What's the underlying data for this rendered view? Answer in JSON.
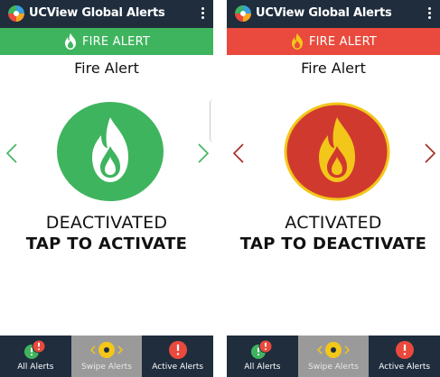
{
  "screens": [
    {
      "app_title": "UCView Global Alerts",
      "banner_label": "FIRE ALERT",
      "alert_title": "Fire Alert",
      "status": "DEACTIVATED",
      "action": "TAP TO ACTIVATE",
      "colors": {
        "banner": "#3fb45e",
        "icon_fill": "#3fb45e",
        "flame": "#ffffff",
        "arrows": "#3fb45e"
      },
      "nav": [
        {
          "label": "All Alerts",
          "icon": "all-alerts-icon",
          "selected": false
        },
        {
          "label": "Swipe Alerts",
          "icon": "swipe-alerts-icon",
          "selected": true
        },
        {
          "label": "Active Alerts",
          "icon": "active-alerts-icon",
          "selected": false
        }
      ]
    },
    {
      "app_title": "UCView Global Alerts",
      "banner_label": "FIRE ALERT",
      "alert_title": "Fire Alert",
      "status": "ACTIVATED",
      "action": "TAP TO DEACTIVATE",
      "colors": {
        "banner": "#e94a3d",
        "icon_fill": "#d03a2e",
        "icon_ring": "#f3c71a",
        "flame": "#f3c71a",
        "arrows": "#a32a1f"
      },
      "nav": [
        {
          "label": "All Alerts",
          "icon": "all-alerts-icon",
          "selected": false
        },
        {
          "label": "Swipe Alerts",
          "icon": "swipe-alerts-icon",
          "selected": true
        },
        {
          "label": "Active Alerts",
          "icon": "active-alerts-icon",
          "selected": false
        }
      ]
    }
  ]
}
